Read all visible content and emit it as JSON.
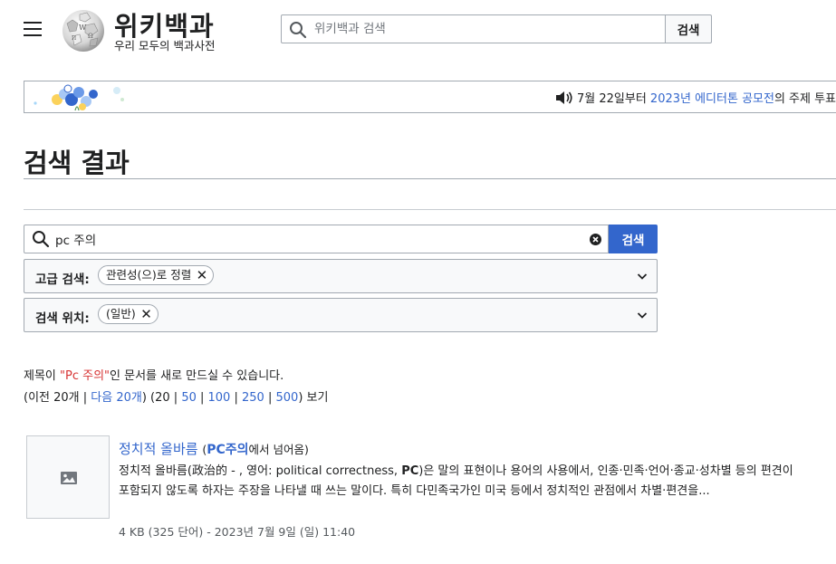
{
  "header": {
    "logo_title": "위키백과",
    "logo_tagline": "우리 모두의 백과사전",
    "search_placeholder": "위키백과 검색",
    "search_button": "검색"
  },
  "banner": {
    "text_before": "7월 22일부터 ",
    "link": "2023년 에디터톤 공모전",
    "text_after": "의 주제 투표"
  },
  "page": {
    "title": "검색 결과"
  },
  "search": {
    "query": "pc 주의",
    "button": "검색"
  },
  "filters": {
    "advanced_label": "고급 검색:",
    "advanced_chip": "관련성(으)로 정렬",
    "location_label": "검색 위치:",
    "location_chip": "(일반)"
  },
  "notice": {
    "before": "제목이 ",
    "red": "\"Pc 주의\"",
    "after": "인 문서를 새로 만드실 수 있습니다."
  },
  "pager": {
    "prev": "(이전 20개 | ",
    "next": "다음 20개",
    "mid": ") (20 | ",
    "o50": "50",
    "o100": "100",
    "o250": "250",
    "o500": "500",
    "end": ") 보기",
    "sep": " | "
  },
  "results": [
    {
      "title": "정치적 올바름",
      "redirect_open": "(",
      "redirect_term": "PC주의",
      "redirect_text": "에서 넘어옴)",
      "snippet_1": "정치적 올바름(政治的 - , 영어: political correctness, ",
      "snippet_bold": "PC",
      "snippet_2": ")은 말의 표현이나 용어의 사용에서, 인종·민족·언어·종교·성차별 등의 편견이 포함되지 않도록 하자는 주장을 나타낼 때 쓰는 말이다. 특히 다민족국가인 미국 등에서 정치적인 관점에서 차별·편견을...",
      "meta": "4 KB (325 단어) - 2023년 7월 9일 (일) 11:40"
    }
  ],
  "icons": {
    "menu": "hamburger-menu-icon",
    "search": "magnifier-icon",
    "clear": "clear-circle-icon",
    "chevron": "chevron-down-icon",
    "speaker": "speaker-icon",
    "image": "image-placeholder-icon"
  },
  "colors": {
    "link": "#3366cc",
    "red_link": "#d73333",
    "primary_button": "#3366cc",
    "border": "#a2a9b1"
  }
}
